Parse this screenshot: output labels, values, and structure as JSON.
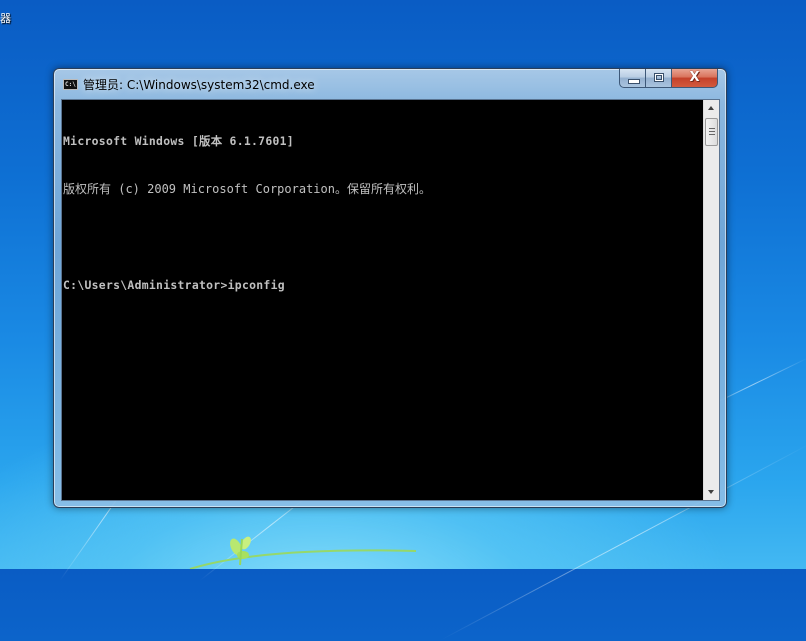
{
  "desktop": {
    "icon_label_fragment": "器"
  },
  "window": {
    "title": "管理员: C:\\Windows\\system32\\cmd.exe",
    "app_icon": "cmd-icon",
    "app_icon_text": "C:\\",
    "buttons": {
      "minimize": "minimize",
      "maximize": "maximize",
      "close": "X"
    }
  },
  "console": {
    "lines": [
      "Microsoft Windows [版本 6.1.7601]",
      "版权所有 (c) 2009 Microsoft Corporation。保留所有权利。",
      "",
      "C:\\Users\\Administrator>ipconfig"
    ],
    "prompt": "C:\\Users\\Administrator>",
    "current_command": "ipconfig",
    "text_color": "#c0c0c0",
    "background_color": "#000000"
  },
  "scrollbar": {
    "up_arrow": "scroll-up",
    "down_arrow": "scroll-down",
    "position_fraction": 0.0
  },
  "colors": {
    "desktop_top": "#0a5cc4",
    "desktop_bottom": "#43b8f2",
    "close_button": "#c4412a",
    "frame_glass": "#96bee1"
  }
}
